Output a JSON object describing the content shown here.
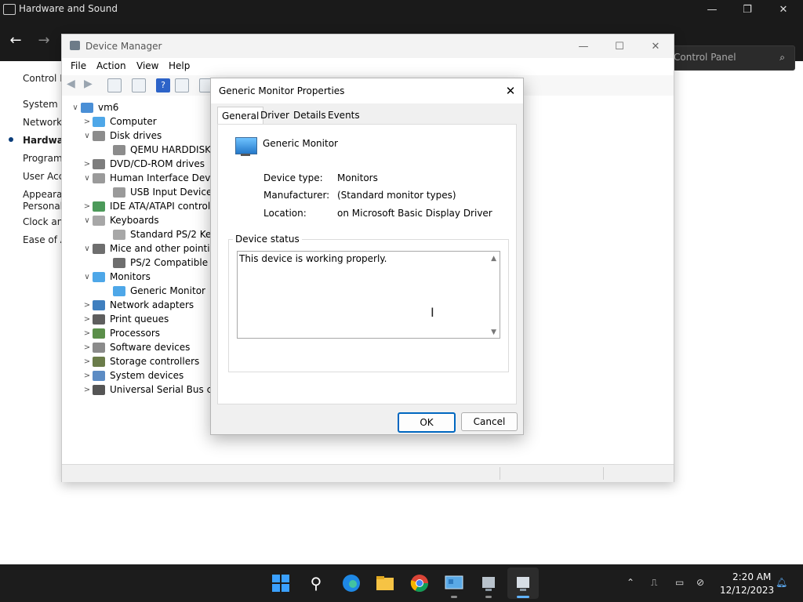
{
  "control_panel": {
    "title": "Hardware and Sound",
    "search_placeholder": "Control Panel",
    "sidebar": [
      {
        "label": "Control P"
      },
      {
        "label": "System ar"
      },
      {
        "label": "Network a"
      },
      {
        "label": "Hardwar"
      },
      {
        "label": "Programs"
      },
      {
        "label": "User Acco"
      },
      {
        "label": "Appearan"
      },
      {
        "label": "Personaliz"
      },
      {
        "label": "Clock and"
      },
      {
        "label": "Ease of A"
      }
    ]
  },
  "device_manager": {
    "title": "Device Manager",
    "menu": [
      "File",
      "Action",
      "View",
      "Help"
    ],
    "tree": [
      {
        "label": "vm6",
        "chev": "∨",
        "icon": "computer-icon"
      },
      {
        "label": "Computer",
        "chev": ">",
        "icon": "monitor-icon"
      },
      {
        "label": "Disk drives",
        "chev": "∨",
        "icon": "disk-drive-icon"
      },
      {
        "label": "QEMU HARDDISK",
        "chev": "",
        "icon": "disk-drive-icon"
      },
      {
        "label": "DVD/CD-ROM drives",
        "chev": ">",
        "icon": "dvd-drive-icon"
      },
      {
        "label": "Human Interface Device",
        "chev": "∨",
        "icon": "hid-icon"
      },
      {
        "label": "USB Input Device",
        "chev": "",
        "icon": "hid-icon"
      },
      {
        "label": "IDE ATA/ATAPI controlle",
        "chev": ">",
        "icon": "controller-icon"
      },
      {
        "label": "Keyboards",
        "chev": "∨",
        "icon": "keyboard-icon"
      },
      {
        "label": "Standard PS/2 Keybo",
        "chev": "",
        "icon": "keyboard-icon"
      },
      {
        "label": "Mice and other pointing",
        "chev": "∨",
        "icon": "mouse-icon"
      },
      {
        "label": "PS/2 Compatible Mo",
        "chev": "",
        "icon": "mouse-icon"
      },
      {
        "label": "Monitors",
        "chev": "∨",
        "icon": "monitor-icon"
      },
      {
        "label": "Generic Monitor",
        "chev": "",
        "icon": "monitor-icon"
      },
      {
        "label": "Network adapters",
        "chev": ">",
        "icon": "network-adapter-icon"
      },
      {
        "label": "Print queues",
        "chev": ">",
        "icon": "printer-icon"
      },
      {
        "label": "Processors",
        "chev": ">",
        "icon": "processor-icon"
      },
      {
        "label": "Software devices",
        "chev": ">",
        "icon": "software-device-icon"
      },
      {
        "label": "Storage controllers",
        "chev": ">",
        "icon": "storage-controller-icon"
      },
      {
        "label": "System devices",
        "chev": ">",
        "icon": "system-device-icon"
      },
      {
        "label": "Universal Serial Bus conf",
        "chev": ">",
        "icon": "usb-icon"
      }
    ]
  },
  "dialog": {
    "title": "Generic Monitor Properties",
    "tabs": [
      "General",
      "Driver",
      "Details",
      "Events"
    ],
    "device_name": "Generic Monitor",
    "device_type_label": "Device type:",
    "device_type_value": "Monitors",
    "manufacturer_label": "Manufacturer:",
    "manufacturer_value": "(Standard monitor types)",
    "location_label": "Location:",
    "location_value": "on Microsoft Basic Display Driver",
    "status_group_label": "Device status",
    "status_text": "This device is working properly.",
    "ok_label": "OK",
    "cancel_label": "Cancel"
  },
  "taskbar": {
    "time": "2:20 AM",
    "date": "12/12/2023"
  }
}
